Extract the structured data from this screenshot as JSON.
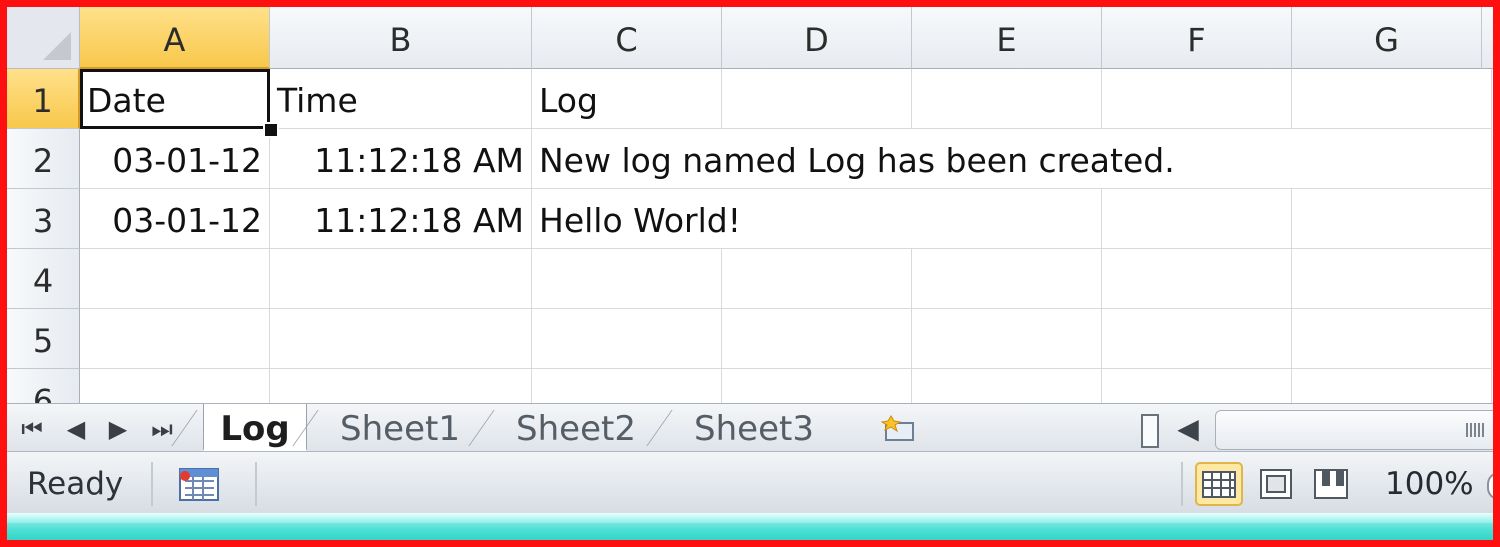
{
  "columns": [
    "A",
    "B",
    "C",
    "D",
    "E",
    "F",
    "G"
  ],
  "rows": [
    "1",
    "2",
    "3",
    "4",
    "5",
    "6"
  ],
  "cells": {
    "A1": "Date",
    "B1": "Time",
    "C1": "Log",
    "A2": "03-01-12",
    "B2": "11:12:18 AM",
    "C2": "New log named Log has been created.",
    "A3": "03-01-12",
    "B3": "11:12:18 AM",
    "C3": "Hello World!"
  },
  "selection": {
    "active_cell": "A1",
    "active_column": "A",
    "active_row": "1"
  },
  "sheet_tabs": [
    {
      "label": "Log",
      "active": true
    },
    {
      "label": "Sheet1",
      "active": false
    },
    {
      "label": "Sheet2",
      "active": false
    },
    {
      "label": "Sheet3",
      "active": false
    }
  ],
  "navigation_icons": [
    "first-sheet-icon",
    "previous-sheet-icon",
    "next-sheet-icon",
    "last-sheet-icon"
  ],
  "status": {
    "mode": "Ready",
    "zoom": "100%"
  },
  "views": [
    "normal-view-icon",
    "page-layout-view-icon",
    "page-break-preview-icon"
  ],
  "colors": {
    "frame": "#ff1010",
    "selection": "#f8c84c",
    "taskbar_accent": "#23cfc3"
  }
}
